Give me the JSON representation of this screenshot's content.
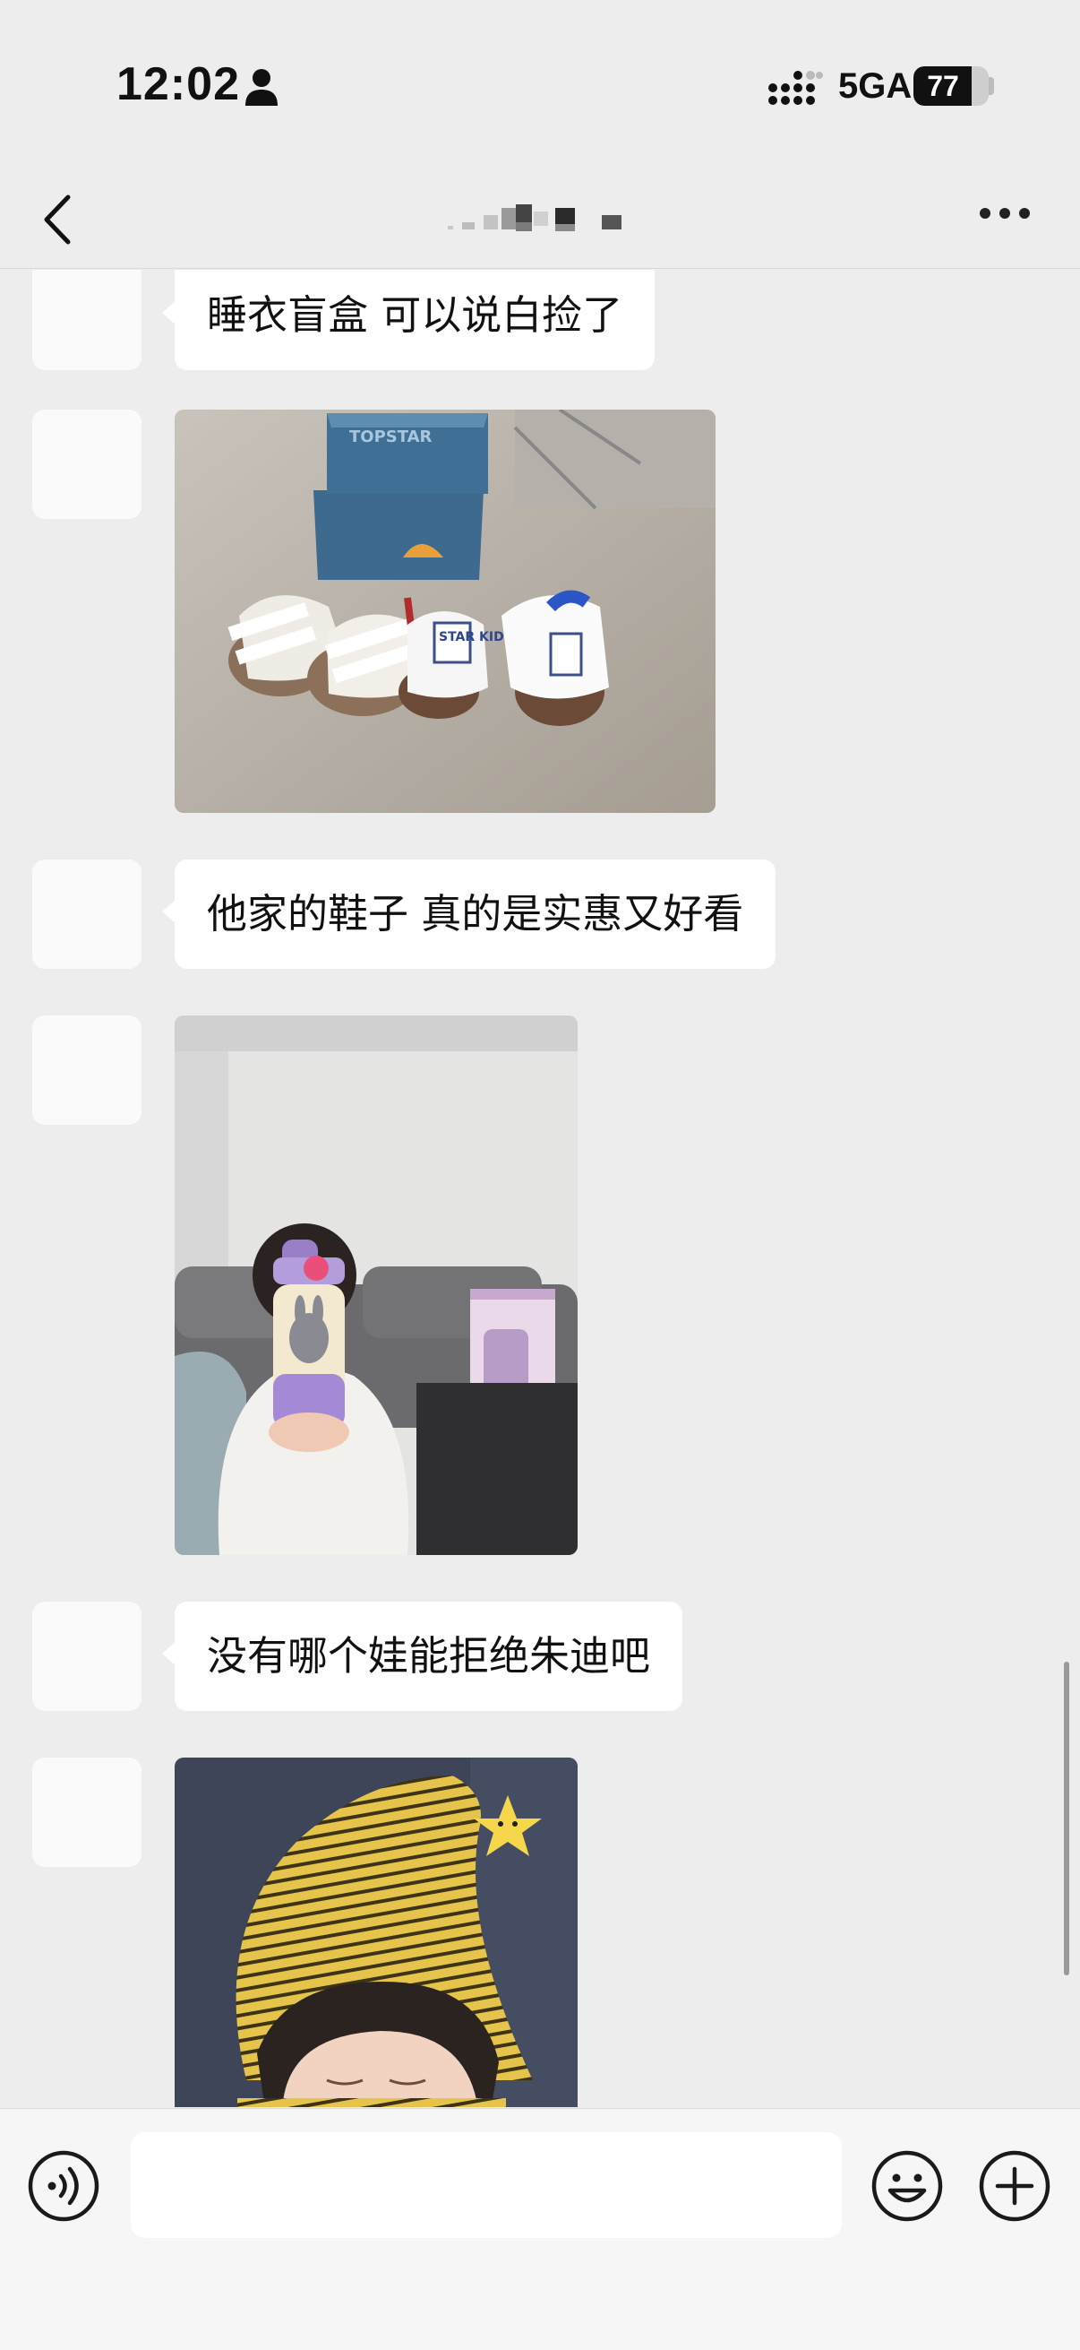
{
  "status_bar": {
    "time": "12:02",
    "network": "5GA",
    "battery_level": "77",
    "battery_fraction": 0.77
  },
  "nav_bar": {
    "title": ""
  },
  "messages": [
    {
      "type": "text",
      "text": "睡衣盲盒 可以说白捡了"
    },
    {
      "type": "image",
      "content": "shoes-photo",
      "box_text": "TOPSTAR",
      "label_text": "STAR KIDS"
    },
    {
      "type": "text",
      "text": "他家的鞋子 真的是实惠又好看"
    },
    {
      "type": "image",
      "content": "water-bottle-photo"
    },
    {
      "type": "text",
      "text": "没有哪个娃能拒绝朱迪吧"
    },
    {
      "type": "image",
      "content": "striped-hat-photo"
    }
  ],
  "input_bar": {
    "placeholder": ""
  },
  "colors": {
    "background": "#ededed",
    "bubble": "#ffffff",
    "input_bar": "#f6f6f6"
  }
}
